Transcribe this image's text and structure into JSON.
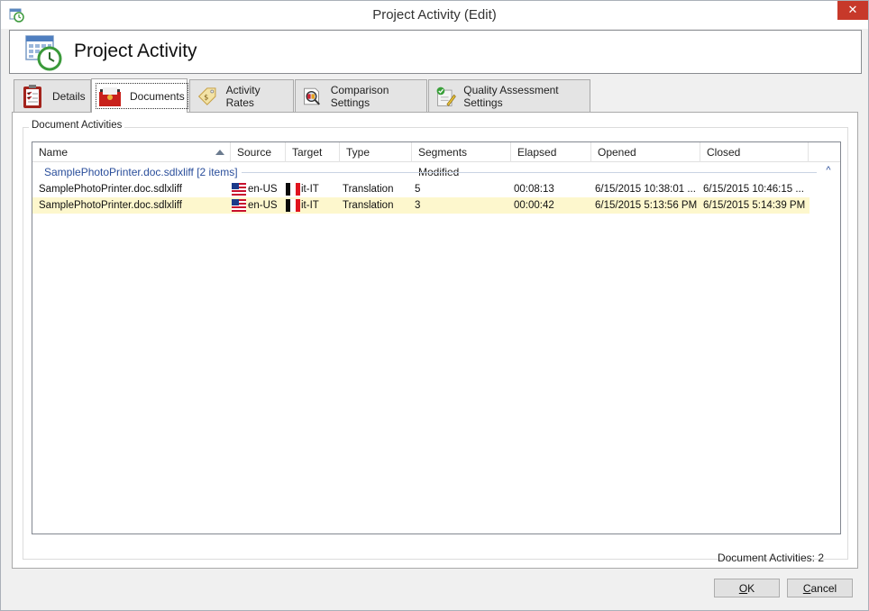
{
  "window": {
    "title": "Project Activity (Edit)",
    "close_glyph": "✕"
  },
  "banner": {
    "title": "Project Activity",
    "icon": "calendar-clock-icon"
  },
  "tabs": [
    {
      "label": "Details",
      "icon": "clipboard-icon",
      "active": false
    },
    {
      "label": "Documents",
      "icon": "folder-documents-icon",
      "active": true
    },
    {
      "label": "Activity Rates",
      "icon": "price-tag-icon",
      "active": false
    },
    {
      "label": "Comparison Settings",
      "icon": "magnifier-compare-icon",
      "active": false
    },
    {
      "label": "Quality Assessment Settings",
      "icon": "checklist-pencil-icon",
      "active": false
    }
  ],
  "documents": {
    "group_title": "Document Activities",
    "columns": [
      "Name",
      "Source",
      "Target",
      "Type",
      "Segments Modified",
      "Elapsed",
      "Opened",
      "Closed"
    ],
    "sort_column": "Name",
    "group": {
      "label": "SamplePhotoPrinter.doc.sdlxliff [2 items]",
      "caret": "^"
    },
    "rows": [
      {
        "name": "SamplePhotoPrinter.doc.sdlxliff",
        "source": "en-US",
        "target": "it-IT",
        "type": "Translation",
        "segments_modified": "5",
        "elapsed": "00:08:13",
        "opened": "6/15/2015 10:38:01 ...",
        "closed": "6/15/2015 10:46:15 ...",
        "selected": false
      },
      {
        "name": "SamplePhotoPrinter.doc.sdlxliff",
        "source": "en-US",
        "target": "it-IT",
        "type": "Translation",
        "segments_modified": "3",
        "elapsed": "00:00:42",
        "opened": "6/15/2015 5:13:56 PM",
        "closed": "6/15/2015 5:14:39 PM",
        "selected": true
      }
    ],
    "status": "Document Activities: 2"
  },
  "buttons": {
    "ok_mnemonic": "O",
    "ok_rest": "K",
    "cancel_mnemonic": "C",
    "cancel_rest": "ancel"
  },
  "colors": {
    "selected_row": "#fdf7cd",
    "group_text": "#2a4e9b",
    "close_button": "#c7392a"
  }
}
